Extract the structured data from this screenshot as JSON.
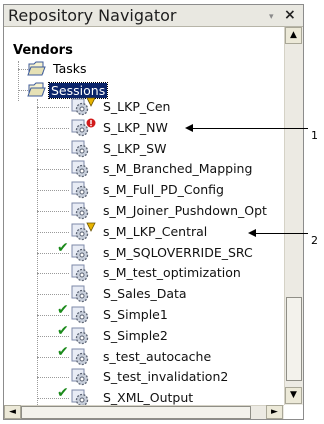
{
  "panel": {
    "title": "Repository Navigator",
    "menu_glyph": "▾",
    "close_glyph": "×"
  },
  "tree": {
    "root": "Vendors",
    "folders": [
      {
        "label": "Tasks",
        "icon": "folder-icon"
      },
      {
        "label": "Sessions",
        "icon": "folder-icon",
        "selected": true
      }
    ],
    "sessions": [
      {
        "label": "S_LKP_Cen",
        "badge": "warning"
      },
      {
        "label": "S_LKP_NW",
        "badge": "error"
      },
      {
        "label": "S_LKP_SW"
      },
      {
        "label": "s_M_Branched_Mapping"
      },
      {
        "label": "s_M_Full_PD_Config"
      },
      {
        "label": "s_M_Joiner_Pushdown_Opt"
      },
      {
        "label": "s_M_LKP_Central",
        "badge": "warning"
      },
      {
        "label": "s_M_SQLOVERRIDE_SRC",
        "checked": true
      },
      {
        "label": "s_M_test_optimization"
      },
      {
        "label": "S_Sales_Data"
      },
      {
        "label": "S_Simple1",
        "checked": true
      },
      {
        "label": "S_Simple2",
        "checked": true
      },
      {
        "label": "s_test_autocache",
        "checked": true
      },
      {
        "label": "S_test_invalidation2"
      },
      {
        "label": "S_XML_Output",
        "checked": true
      }
    ]
  },
  "callouts": [
    {
      "number": "1"
    },
    {
      "number": "2"
    }
  ],
  "scrollbar": {
    "up": "▲",
    "down": "▼",
    "left": "◄",
    "right": "►"
  },
  "colors": {
    "selection": "#0a246a",
    "check": "#1b8a1b",
    "warning": "#e8b400",
    "error": "#d11a1a"
  }
}
